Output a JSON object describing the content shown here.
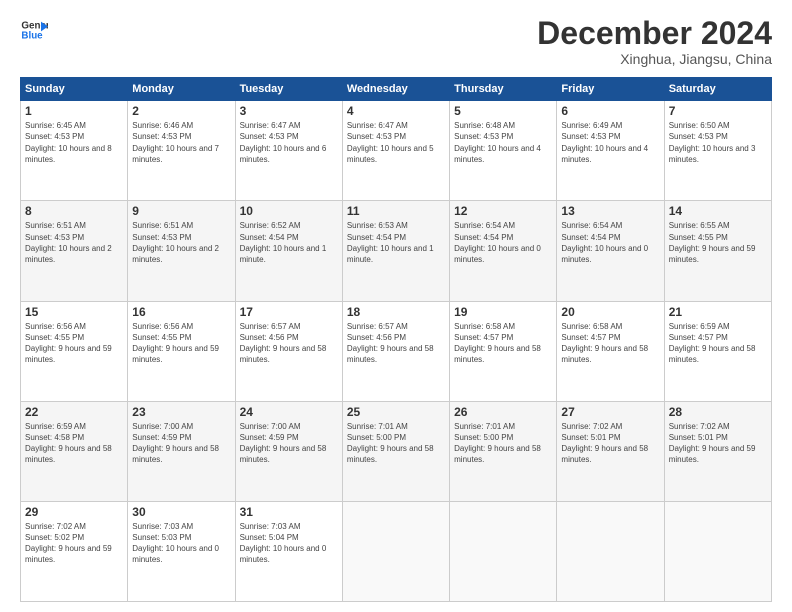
{
  "logo": {
    "text_general": "General",
    "text_blue": "Blue"
  },
  "header": {
    "month": "December 2024",
    "location": "Xinghua, Jiangsu, China"
  },
  "days": [
    "Sunday",
    "Monday",
    "Tuesday",
    "Wednesday",
    "Thursday",
    "Friday",
    "Saturday"
  ],
  "weeks": [
    [
      {
        "num": "1",
        "sunrise": "6:45 AM",
        "sunset": "4:53 PM",
        "daylight": "10 hours and 8 minutes."
      },
      {
        "num": "2",
        "sunrise": "6:46 AM",
        "sunset": "4:53 PM",
        "daylight": "10 hours and 7 minutes."
      },
      {
        "num": "3",
        "sunrise": "6:47 AM",
        "sunset": "4:53 PM",
        "daylight": "10 hours and 6 minutes."
      },
      {
        "num": "4",
        "sunrise": "6:47 AM",
        "sunset": "4:53 PM",
        "daylight": "10 hours and 5 minutes."
      },
      {
        "num": "5",
        "sunrise": "6:48 AM",
        "sunset": "4:53 PM",
        "daylight": "10 hours and 4 minutes."
      },
      {
        "num": "6",
        "sunrise": "6:49 AM",
        "sunset": "4:53 PM",
        "daylight": "10 hours and 4 minutes."
      },
      {
        "num": "7",
        "sunrise": "6:50 AM",
        "sunset": "4:53 PM",
        "daylight": "10 hours and 3 minutes."
      }
    ],
    [
      {
        "num": "8",
        "sunrise": "6:51 AM",
        "sunset": "4:53 PM",
        "daylight": "10 hours and 2 minutes."
      },
      {
        "num": "9",
        "sunrise": "6:51 AM",
        "sunset": "4:53 PM",
        "daylight": "10 hours and 2 minutes."
      },
      {
        "num": "10",
        "sunrise": "6:52 AM",
        "sunset": "4:54 PM",
        "daylight": "10 hours and 1 minute."
      },
      {
        "num": "11",
        "sunrise": "6:53 AM",
        "sunset": "4:54 PM",
        "daylight": "10 hours and 1 minute."
      },
      {
        "num": "12",
        "sunrise": "6:54 AM",
        "sunset": "4:54 PM",
        "daylight": "10 hours and 0 minutes."
      },
      {
        "num": "13",
        "sunrise": "6:54 AM",
        "sunset": "4:54 PM",
        "daylight": "10 hours and 0 minutes."
      },
      {
        "num": "14",
        "sunrise": "6:55 AM",
        "sunset": "4:55 PM",
        "daylight": "9 hours and 59 minutes."
      }
    ],
    [
      {
        "num": "15",
        "sunrise": "6:56 AM",
        "sunset": "4:55 PM",
        "daylight": "9 hours and 59 minutes."
      },
      {
        "num": "16",
        "sunrise": "6:56 AM",
        "sunset": "4:55 PM",
        "daylight": "9 hours and 59 minutes."
      },
      {
        "num": "17",
        "sunrise": "6:57 AM",
        "sunset": "4:56 PM",
        "daylight": "9 hours and 58 minutes."
      },
      {
        "num": "18",
        "sunrise": "6:57 AM",
        "sunset": "4:56 PM",
        "daylight": "9 hours and 58 minutes."
      },
      {
        "num": "19",
        "sunrise": "6:58 AM",
        "sunset": "4:57 PM",
        "daylight": "9 hours and 58 minutes."
      },
      {
        "num": "20",
        "sunrise": "6:58 AM",
        "sunset": "4:57 PM",
        "daylight": "9 hours and 58 minutes."
      },
      {
        "num": "21",
        "sunrise": "6:59 AM",
        "sunset": "4:57 PM",
        "daylight": "9 hours and 58 minutes."
      }
    ],
    [
      {
        "num": "22",
        "sunrise": "6:59 AM",
        "sunset": "4:58 PM",
        "daylight": "9 hours and 58 minutes."
      },
      {
        "num": "23",
        "sunrise": "7:00 AM",
        "sunset": "4:59 PM",
        "daylight": "9 hours and 58 minutes."
      },
      {
        "num": "24",
        "sunrise": "7:00 AM",
        "sunset": "4:59 PM",
        "daylight": "9 hours and 58 minutes."
      },
      {
        "num": "25",
        "sunrise": "7:01 AM",
        "sunset": "5:00 PM",
        "daylight": "9 hours and 58 minutes."
      },
      {
        "num": "26",
        "sunrise": "7:01 AM",
        "sunset": "5:00 PM",
        "daylight": "9 hours and 58 minutes."
      },
      {
        "num": "27",
        "sunrise": "7:02 AM",
        "sunset": "5:01 PM",
        "daylight": "9 hours and 58 minutes."
      },
      {
        "num": "28",
        "sunrise": "7:02 AM",
        "sunset": "5:01 PM",
        "daylight": "9 hours and 59 minutes."
      }
    ],
    [
      {
        "num": "29",
        "sunrise": "7:02 AM",
        "sunset": "5:02 PM",
        "daylight": "9 hours and 59 minutes."
      },
      {
        "num": "30",
        "sunrise": "7:03 AM",
        "sunset": "5:03 PM",
        "daylight": "10 hours and 0 minutes."
      },
      {
        "num": "31",
        "sunrise": "7:03 AM",
        "sunset": "5:04 PM",
        "daylight": "10 hours and 0 minutes."
      },
      null,
      null,
      null,
      null
    ]
  ]
}
